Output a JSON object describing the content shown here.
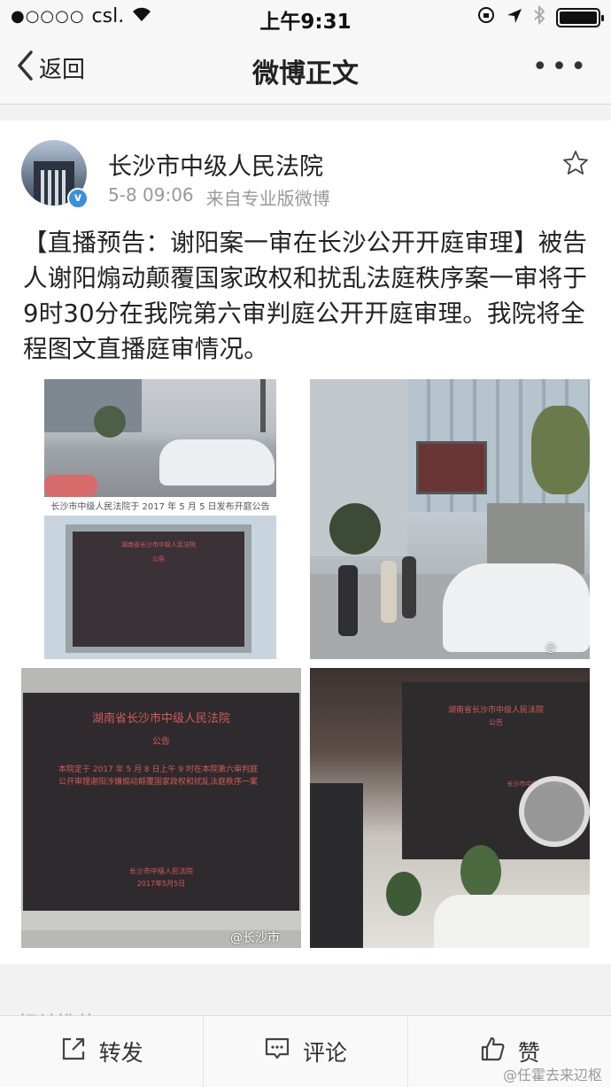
{
  "status_bar": {
    "signal_dots": "●○○○○",
    "carrier": "csl.",
    "time": "上午9:31"
  },
  "nav": {
    "back_label": "返回",
    "title": "微博正文",
    "more": "•••"
  },
  "post": {
    "author": "长沙市中级人民法院",
    "timestamp": "5-8 09:06",
    "source": "来自专业版微博",
    "text": "【直播预告：谢阳案一审在长沙公开开庭审理】被告人谢阳煽动颠覆国家政权和扰乱法庭秩序案一审将于9时30分在我院第六审判庭公开开庭审理。我院将全程图文直播庭审情况。",
    "verified_badge": "v",
    "images": {
      "img1_caption": "长沙市中级人民法院于 2017 年 5 月 5 日发布开庭公告",
      "img2_heading": "湖南省长沙市中级人民法院",
      "img2_sub": "公告",
      "img4_heading": "湖南省长沙市中级人民法院",
      "img4_sub": "公告",
      "img4_body": "本院定于 2017 年 5 月 8 日上午 9 时在本院第六审判庭公开审理谢阳涉嫌煽动颠覆国家政权和扰乱法庭秩序一案",
      "img4_footer": "长沙市中级人民法院",
      "img4_date": "2017年5月5日",
      "img5_heading": "湖南省长沙市中级人民法院",
      "img5_sub": "公告",
      "img5_footer": "长沙市中级人民法院",
      "watermark_weibo": "@",
      "watermark_changsha": "@长沙市"
    }
  },
  "related_label": "相关推荐",
  "toolbar": {
    "repost": "转发",
    "comment": "评论",
    "like": "赞"
  },
  "bottom_watermark": "@任霍去来辺枢",
  "colors": {
    "verified": "#3b8ede",
    "screen_text": "#d25b5b"
  },
  "icons": [
    "wifi-icon",
    "lock-rotation-icon",
    "location-icon",
    "bluetooth-icon",
    "battery-icon",
    "back-chevron-icon",
    "star-icon",
    "repost-icon",
    "comment-icon",
    "like-icon"
  ]
}
